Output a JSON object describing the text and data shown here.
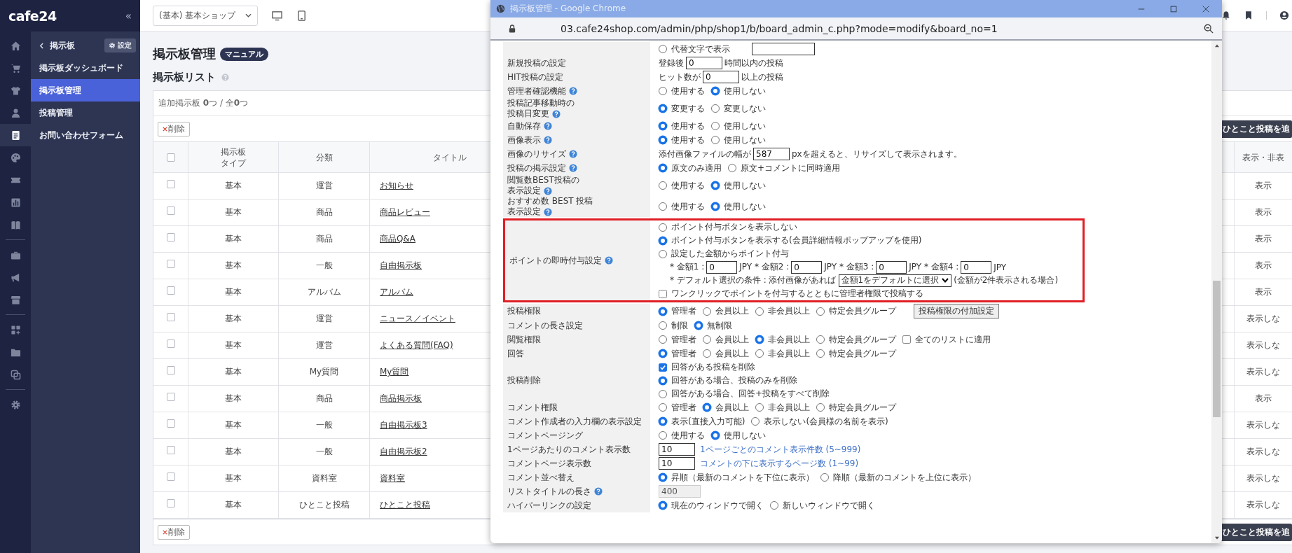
{
  "sidebar": {
    "logo": "cafe24",
    "collapse": "«",
    "icon_rail": [
      {
        "selected": false
      },
      {
        "selected": false
      },
      {
        "selected": false
      },
      {
        "selected": false
      },
      {
        "selected": true
      },
      {
        "selected": false
      },
      {
        "selected": false
      },
      {
        "selected": false
      },
      {
        "selected": false
      },
      {
        "selected": false
      },
      {
        "selected": false
      },
      {
        "selected": false
      },
      {
        "selected": false
      },
      {
        "selected": false
      },
      {
        "selected": false
      },
      {
        "selected": false
      }
    ],
    "back": "掲示板",
    "settings": "設定",
    "items": [
      {
        "label": "掲示板ダッシュボード",
        "selected": false
      },
      {
        "label": "掲示板管理",
        "selected": true
      },
      {
        "label": "投稿管理",
        "selected": false
      },
      {
        "label": "お問い合わせフォーム",
        "selected": false
      }
    ]
  },
  "topbar": {
    "shop_select": "(基本) 基本ショップ"
  },
  "page": {
    "title": "掲示板管理",
    "manual_badge": "マニュアル",
    "list_title": "掲示板リスト",
    "summary": "追加掲示板 **0**つ / 全**0**つ",
    "delete_buttons": [
      "削除",
      "削除"
    ],
    "add_buttons": [
      "ひとこと投稿を追",
      "ひとこと投稿を追"
    ]
  },
  "table": {
    "header_checked": false,
    "columns": [
      [
        "掲示板",
        "タイプ"
      ],
      "分類",
      "タイトル",
      "表示・非表"
    ],
    "rows": [
      {
        "checked": false,
        "type": "基本",
        "category": "運営",
        "title": "お知らせ",
        "visibility": "表示"
      },
      {
        "checked": false,
        "type": "基本",
        "category": "商品",
        "title": "商品レビュー",
        "visibility": "表示"
      },
      {
        "checked": false,
        "type": "基本",
        "category": "商品",
        "title": "商品Q&A",
        "visibility": "表示"
      },
      {
        "checked": false,
        "type": "基本",
        "category": "一般",
        "title": "自由掲示板",
        "visibility": "表示"
      },
      {
        "checked": false,
        "type": "基本",
        "category": "アルバム",
        "title": "アルバム",
        "visibility": "表示"
      },
      {
        "checked": false,
        "type": "基本",
        "category": "運営",
        "title": "ニュース／イベント",
        "visibility": "表示しな"
      },
      {
        "checked": false,
        "type": "基本",
        "category": "運営",
        "title": "よくある質問(FAQ)",
        "visibility": "表示しな"
      },
      {
        "checked": false,
        "type": "基本",
        "category": "My質問",
        "title": "My質問",
        "visibility": "表示しな"
      },
      {
        "checked": false,
        "type": "基本",
        "category": "商品",
        "title": "商品掲示板",
        "visibility": "表示"
      },
      {
        "checked": false,
        "type": "基本",
        "category": "一般",
        "title": "自由掲示板3",
        "visibility": "表示しな"
      },
      {
        "checked": false,
        "type": "基本",
        "category": "一般",
        "title": "自由掲示板2",
        "visibility": "表示しな"
      },
      {
        "checked": false,
        "type": "基本",
        "category": "資料室",
        "title": "資料室",
        "visibility": "表示しな"
      },
      {
        "checked": false,
        "type": "基本",
        "category": "ひとこと投稿",
        "title": "ひとこと投稿",
        "visibility": "表示しな"
      }
    ]
  },
  "popup": {
    "window_title": "掲示板管理 - Google Chrome",
    "url": "03.cafe24shop.com/admin/php/shop1/b/board_admin_c.php?mode=modify&board_no=1",
    "rows": [
      {
        "highlighted": false,
        "lines": [
          {
            "parts": [
              {
                "kind": "radio",
                "label": "代替文字で表示",
                "selected": false
              },
              {
                "kind": "input",
                "disabled": false
              }
            ]
          }
        ]
      },
      {
        "label": "新規投稿の設定",
        "help": false,
        "highlighted": false,
        "lines": [
          {
            "parts": [
              {
                "kind": "text",
                "text": "登録後"
              },
              {
                "kind": "input",
                "value": "0",
                "disabled": false
              },
              {
                "kind": "text",
                "text": "時間以内の投稿"
              }
            ]
          }
        ]
      },
      {
        "label": "HIT投稿の設定",
        "help": false,
        "highlighted": false,
        "lines": [
          {
            "parts": [
              {
                "kind": "text",
                "text": "ヒット数が"
              },
              {
                "kind": "input",
                "value": "0",
                "disabled": false
              },
              {
                "kind": "text",
                "text": "以上の投稿"
              }
            ]
          }
        ]
      },
      {
        "label": "管理者確認機能",
        "help": true,
        "highlighted": false,
        "lines": [
          {
            "parts": [
              {
                "kind": "radio",
                "label": "使用する",
                "selected": false
              },
              {
                "kind": "radio",
                "label": "使用しない",
                "selected": true
              }
            ]
          }
        ]
      },
      {
        "label_lines": [
          "投稿記事移動時の",
          "投稿日変更"
        ],
        "help": true,
        "highlighted": false,
        "lines": [
          {
            "parts": [
              {
                "kind": "radio",
                "label": "変更する",
                "selected": true
              },
              {
                "kind": "radio",
                "label": "変更しない",
                "selected": false
              }
            ]
          }
        ]
      },
      {
        "label": "自動保存",
        "help": true,
        "highlighted": false,
        "lines": [
          {
            "parts": [
              {
                "kind": "radio",
                "label": "使用する",
                "selected": true
              },
              {
                "kind": "radio",
                "label": "使用しない",
                "selected": false
              }
            ]
          }
        ]
      },
      {
        "label": "画像表示",
        "help": true,
        "highlighted": false,
        "lines": [
          {
            "parts": [
              {
                "kind": "radio",
                "label": "使用する",
                "selected": true
              },
              {
                "kind": "radio",
                "label": "使用しない",
                "selected": false
              }
            ]
          }
        ]
      },
      {
        "label": "画像のリサイズ",
        "help": true,
        "highlighted": false,
        "lines": [
          {
            "parts": [
              {
                "kind": "text",
                "text": "添付画像ファイルの幅が"
              },
              {
                "kind": "input",
                "value": "587",
                "disabled": false
              },
              {
                "kind": "text",
                "text": "pxを超えると、リサイズして表示されます。"
              }
            ]
          }
        ]
      },
      {
        "label": "投稿の掲示設定",
        "help": true,
        "highlighted": false,
        "lines": [
          {
            "parts": [
              {
                "kind": "radio",
                "label": "原文のみ適用",
                "selected": true
              },
              {
                "kind": "radio",
                "label": "原文+コメントに同時適用",
                "selected": false
              }
            ]
          }
        ]
      },
      {
        "label_lines": [
          "閲覧数BEST投稿の",
          "表示設定"
        ],
        "help": true,
        "highlighted": false,
        "lines": [
          {
            "parts": [
              {
                "kind": "radio",
                "label": "使用する",
                "selected": false
              },
              {
                "kind": "radio",
                "label": "使用しない",
                "selected": true
              }
            ]
          }
        ]
      },
      {
        "label_lines": [
          "おすすめ数 BEST 投稿",
          "表示設定"
        ],
        "help": true,
        "highlighted": false,
        "lines": [
          {
            "parts": [
              {
                "kind": "radio",
                "label": "使用する",
                "selected": false
              },
              {
                "kind": "radio",
                "label": "使用しない",
                "selected": true
              }
            ]
          }
        ]
      },
      {
        "label": "ポイントの即時付与設定",
        "help": true,
        "highlighted": true,
        "lines": [
          {
            "parts": [
              {
                "kind": "radio",
                "label": "ポイント付与ボタンを表示しない",
                "selected": false
              }
            ]
          },
          {
            "parts": [
              {
                "kind": "radio",
                "label": "ポイント付与ボタンを表示する(会員詳細情報ポップアップを使用)",
                "selected": true
              }
            ]
          },
          {
            "parts": [
              {
                "kind": "radio",
                "label": "設定した金額からポイント付与",
                "selected": false
              }
            ],
            "children": [
              {
                "parts": [
                  {
                    "kind": "text",
                    "text": "* 金額1 :"
                  },
                  {
                    "kind": "input",
                    "value": "0",
                    "disabled": false
                  },
                  {
                    "kind": "text",
                    "text": "JPY * 金額2 :"
                  },
                  {
                    "kind": "input",
                    "value": "0",
                    "disabled": false
                  },
                  {
                    "kind": "text",
                    "text": "JPY * 金額3 :"
                  },
                  {
                    "kind": "input",
                    "value": "0",
                    "disabled": false
                  },
                  {
                    "kind": "text",
                    "text": "JPY * 金額4 :"
                  },
                  {
                    "kind": "input",
                    "value": "0",
                    "disabled": false
                  },
                  {
                    "kind": "text",
                    "text": "JPY"
                  }
                ]
              },
              {
                "parts": [
                  {
                    "kind": "text",
                    "text": "* デフォルト選択の条件 : 添付画像があれば"
                  },
                  {
                    "kind": "select",
                    "value": "金額1をデフォルトに選択"
                  },
                  {
                    "kind": "text",
                    "text": "(金額が2件表示される場合)"
                  }
                ]
              }
            ]
          },
          {
            "parts": [
              {
                "kind": "checkbox",
                "label": "ワンクリックでポイントを付与するとともに管理者権限で投稿する",
                "checked": false
              }
            ]
          }
        ]
      },
      {
        "label": "投稿権限",
        "help": false,
        "highlighted": false,
        "lines": [
          {
            "parts": [
              {
                "kind": "radio",
                "label": "管理者",
                "selected": true
              },
              {
                "kind": "radio",
                "label": "会員以上",
                "selected": false
              },
              {
                "kind": "radio",
                "label": "非会員以上",
                "selected": false
              },
              {
                "kind": "radio",
                "label": "特定会員グループ",
                "selected": false
              },
              {
                "kind": "button",
                "label": "投稿権限の付加設定"
              }
            ]
          }
        ]
      },
      {
        "label": "コメントの長さ設定",
        "help": false,
        "highlighted": false,
        "lines": [
          {
            "parts": [
              {
                "kind": "radio",
                "label": "制限",
                "selected": false
              },
              {
                "kind": "radio",
                "label": "無制限",
                "selected": true
              }
            ]
          }
        ]
      },
      {
        "label": "閲覧権限",
        "help": false,
        "highlighted": false,
        "lines": [
          {
            "parts": [
              {
                "kind": "radio",
                "label": "管理者",
                "selected": false
              },
              {
                "kind": "radio",
                "label": "会員以上",
                "selected": false
              },
              {
                "kind": "radio",
                "label": "非会員以上",
                "selected": true
              },
              {
                "kind": "radio",
                "label": "特定会員グループ",
                "selected": false
              },
              {
                "kind": "checkbox",
                "label": "全てのリストに適用",
                "checked": false
              }
            ]
          }
        ]
      },
      {
        "label": "回答",
        "help": false,
        "highlighted": false,
        "lines": [
          {
            "parts": [
              {
                "kind": "radio",
                "label": "管理者",
                "selected": true
              },
              {
                "kind": "radio",
                "label": "会員以上",
                "selected": false
              },
              {
                "kind": "radio",
                "label": "非会員以上",
                "selected": false
              },
              {
                "kind": "radio",
                "label": "特定会員グループ",
                "selected": false
              }
            ]
          }
        ]
      },
      {
        "label": "投稿削除",
        "help": false,
        "highlighted": false,
        "lines": [
          {
            "parts": [
              {
                "kind": "checkbox",
                "label": "回答がある投稿を削除",
                "checked": true
              }
            ]
          },
          {
            "parts": [
              {
                "kind": "radio",
                "label": "回答がある場合、投稿のみを削除",
                "selected": true
              }
            ]
          },
          {
            "parts": [
              {
                "kind": "radio",
                "label": "回答がある場合、回答+投稿をすべて削除",
                "selected": false
              }
            ]
          }
        ]
      },
      {
        "label": "コメント権限",
        "help": false,
        "highlighted": false,
        "lines": [
          {
            "parts": [
              {
                "kind": "radio",
                "label": "管理者",
                "selected": false
              },
              {
                "kind": "radio",
                "label": "会員以上",
                "selected": true
              },
              {
                "kind": "radio",
                "label": "非会員以上",
                "selected": false
              },
              {
                "kind": "radio",
                "label": "特定会員グループ",
                "selected": false
              }
            ]
          }
        ]
      },
      {
        "label": "コメント作成者の入力欄の表示設定",
        "help": false,
        "highlighted": false,
        "lines": [
          {
            "parts": [
              {
                "kind": "radio",
                "label": "表示(直接入力可能)",
                "selected": true
              },
              {
                "kind": "radio",
                "label": "表示しない(会員様の名前を表示)",
                "selected": false
              }
            ]
          }
        ]
      },
      {
        "label": "コメントページング",
        "help": false,
        "highlighted": false,
        "lines": [
          {
            "parts": [
              {
                "kind": "radio",
                "label": "使用する",
                "selected": false
              },
              {
                "kind": "radio",
                "label": "使用しない",
                "selected": true
              }
            ]
          }
        ]
      },
      {
        "label": "1ページあたりのコメント表示数",
        "help": false,
        "highlighted": false,
        "lines": [
          {
            "parts": [
              {
                "kind": "input",
                "value": "10",
                "disabled": false
              },
              {
                "kind": "note",
                "text": "1ページごとのコメント表示件数 (5~999)"
              }
            ]
          }
        ]
      },
      {
        "label": "コメントページ表示数",
        "help": false,
        "highlighted": false,
        "lines": [
          {
            "parts": [
              {
                "kind": "input",
                "value": "10",
                "disabled": false
              },
              {
                "kind": "note",
                "text": "コメントの下に表示するページ数 (1~99)"
              }
            ]
          }
        ]
      },
      {
        "label": "コメント並べ替え",
        "help": false,
        "highlighted": false,
        "lines": [
          {
            "parts": [
              {
                "kind": "radio",
                "label": "昇順（最新のコメントを下位に表示）",
                "selected": true
              },
              {
                "kind": "radio",
                "label": "降順（最新のコメントを上位に表示）",
                "selected": false
              }
            ]
          }
        ]
      },
      {
        "label": "リストタイトルの長さ",
        "help": true,
        "highlighted": false,
        "lines": [
          {
            "parts": [
              {
                "kind": "input",
                "value": "400",
                "disabled": true
              }
            ]
          }
        ]
      },
      {
        "label": "ハイパーリンクの設定",
        "help": false,
        "highlighted": false,
        "lines": [
          {
            "parts": [
              {
                "kind": "radio",
                "label": "現在のウィンドウで開く",
                "selected": true
              },
              {
                "kind": "radio",
                "label": "新しいウィンドウで開く",
                "selected": false
              }
            ]
          }
        ]
      }
    ]
  }
}
